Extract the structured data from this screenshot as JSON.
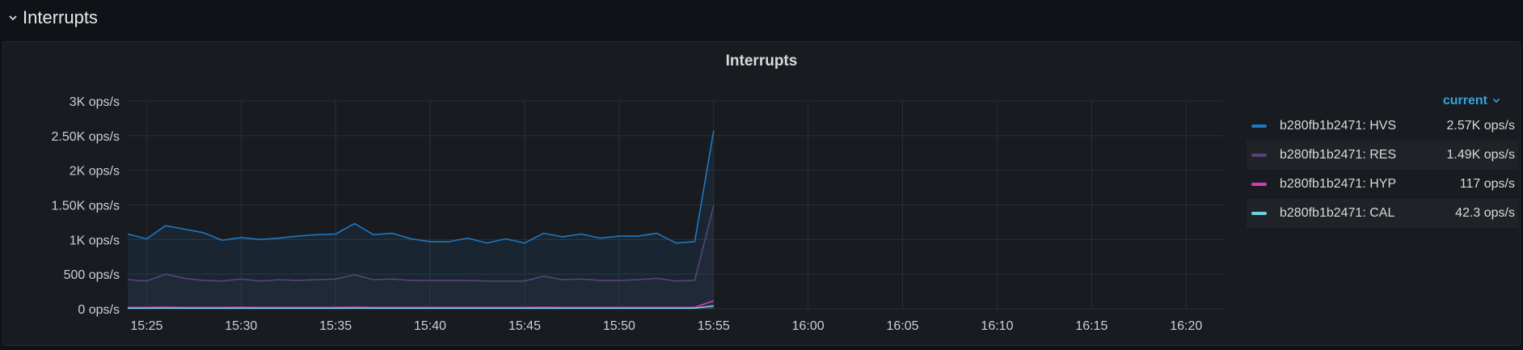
{
  "row": {
    "title": "Interrupts"
  },
  "panel": {
    "title": "Interrupts"
  },
  "legend": {
    "column_header": "current",
    "items": [
      {
        "name": "b280fb1b2471: HVS",
        "value": "2.57K ops/s",
        "color": "#1f78c1"
      },
      {
        "name": "b280fb1b2471: RES",
        "value": "1.49K ops/s",
        "color": "#584477"
      },
      {
        "name": "b280fb1b2471: HYP",
        "value": "117 ops/s",
        "color": "#d63bb0"
      },
      {
        "name": "b280fb1b2471: CAL",
        "value": "42.3 ops/s",
        "color": "#6ed0e0"
      }
    ]
  },
  "chart_data": {
    "type": "line",
    "title": "Interrupts",
    "y_ticks": [
      "0 ops/s",
      "500 ops/s",
      "1K ops/s",
      "1.50K ops/s",
      "2K ops/s",
      "2.50K ops/s",
      "3K ops/s"
    ],
    "ylim": [
      0,
      3000
    ],
    "x_ticks": [
      "15:25",
      "15:30",
      "15:35",
      "15:40",
      "15:45",
      "15:50",
      "15:55",
      "16:00",
      "16:05",
      "16:10",
      "16:15",
      "16:20"
    ],
    "x_range_minutes": [
      "15:24",
      "16:22"
    ],
    "grid": true,
    "legend_position": "right",
    "x": [
      "15:24",
      "15:25",
      "15:26",
      "15:27",
      "15:28",
      "15:29",
      "15:30",
      "15:31",
      "15:32",
      "15:33",
      "15:34",
      "15:35",
      "15:36",
      "15:37",
      "15:38",
      "15:39",
      "15:40",
      "15:41",
      "15:42",
      "15:43",
      "15:44",
      "15:45",
      "15:46",
      "15:47",
      "15:48",
      "15:49",
      "15:50",
      "15:51",
      "15:52",
      "15:53",
      "15:54",
      "15:55"
    ],
    "series": [
      {
        "name": "b280fb1b2471: HVS",
        "color": "#1f78c1",
        "values": [
          1080,
          1010,
          1200,
          1150,
          1100,
          990,
          1030,
          1000,
          1020,
          1050,
          1070,
          1080,
          1230,
          1070,
          1090,
          1010,
          970,
          970,
          1020,
          950,
          1010,
          950,
          1090,
          1040,
          1080,
          1020,
          1050,
          1050,
          1090,
          950,
          970,
          2570
        ]
      },
      {
        "name": "b280fb1b2471: RES",
        "color": "#584477",
        "values": [
          420,
          400,
          500,
          440,
          410,
          400,
          430,
          400,
          420,
          410,
          420,
          430,
          490,
          420,
          430,
          410,
          410,
          410,
          410,
          400,
          400,
          400,
          470,
          420,
          430,
          410,
          410,
          420,
          440,
          400,
          410,
          1490
        ]
      },
      {
        "name": "b280fb1b2471: HYP",
        "color": "#d63bb0",
        "values": [
          20,
          20,
          22,
          20,
          20,
          20,
          21,
          20,
          20,
          20,
          20,
          20,
          22,
          20,
          20,
          20,
          20,
          20,
          20,
          20,
          20,
          20,
          21,
          20,
          20,
          20,
          20,
          20,
          20,
          20,
          20,
          117
        ]
      },
      {
        "name": "b280fb1b2471: CAL",
        "color": "#6ed0e0",
        "values": [
          8,
          8,
          9,
          8,
          8,
          8,
          8,
          8,
          8,
          8,
          8,
          8,
          9,
          8,
          8,
          8,
          8,
          8,
          8,
          8,
          8,
          8,
          8,
          8,
          8,
          8,
          8,
          8,
          8,
          8,
          8,
          42.3
        ]
      }
    ]
  }
}
